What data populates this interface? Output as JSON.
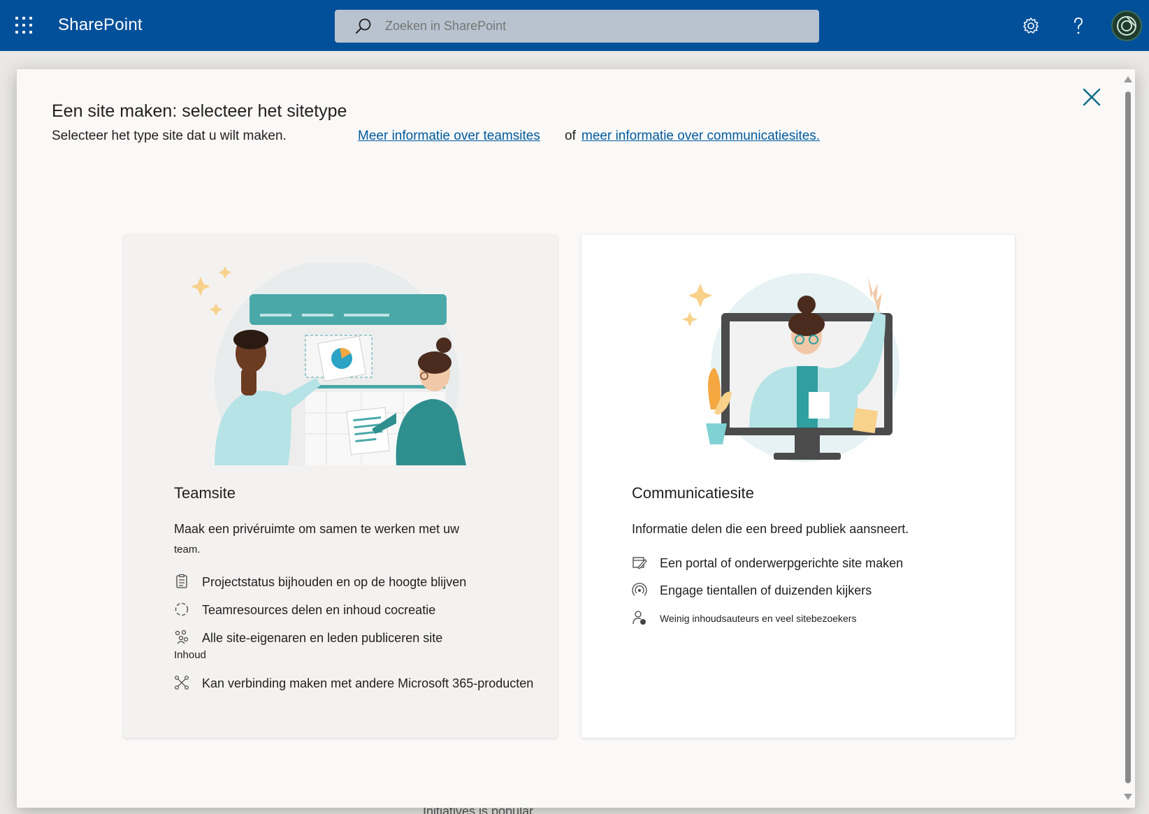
{
  "suitebar": {
    "brand": "SharePoint",
    "search_placeholder": "Zoeken in SharePoint"
  },
  "background": {
    "fragment": "Initiatives is popular"
  },
  "modal": {
    "title": "Een site maken: selecteer het sitetype",
    "subtitle": "Selecteer het type site dat u wilt maken.",
    "link_team": "Meer informatie over teamsites",
    "link_separator": "of",
    "link_comm": "meer informatie over communicatiesites."
  },
  "cards": {
    "team": {
      "title": "Teamsite",
      "desc_line1": "Maak een privéruimte om samen te werken met uw",
      "desc_line2": "team.",
      "features": [
        {
          "icon": "clipboard-checklist-icon",
          "text": "Projectstatus bijhouden en op de hoogte blijven"
        },
        {
          "icon": "circular-arrows-icon",
          "text": "Teamresources delen en inhoud cocreatie"
        },
        {
          "icon": "people-group-icon",
          "text": "Alle site-eigenaren en leden publiceren site",
          "wrap": "Inhoud"
        },
        {
          "icon": "network-nodes-icon",
          "text": "Kan verbinding maken met andere Microsoft 365-producten"
        }
      ]
    },
    "comm": {
      "title": "Communicatiesite",
      "desc": "Informatie delen die een breed publiek aansneert.",
      "features": [
        {
          "icon": "edit-page-icon",
          "text": "Een portal of onderwerpgerichte site maken"
        },
        {
          "icon": "broadcast-icon",
          "text": "Engage tientallen of duizenden kijkers"
        },
        {
          "icon": "person-view-icon",
          "text": "Weinig inhoudsauteurs en veel sitebezoekers"
        }
      ]
    }
  },
  "colors": {
    "suitebar": "#03509a",
    "link": "#005a9e",
    "teal": "#4aa8a8",
    "accent_yellow": "#f8d18a"
  }
}
